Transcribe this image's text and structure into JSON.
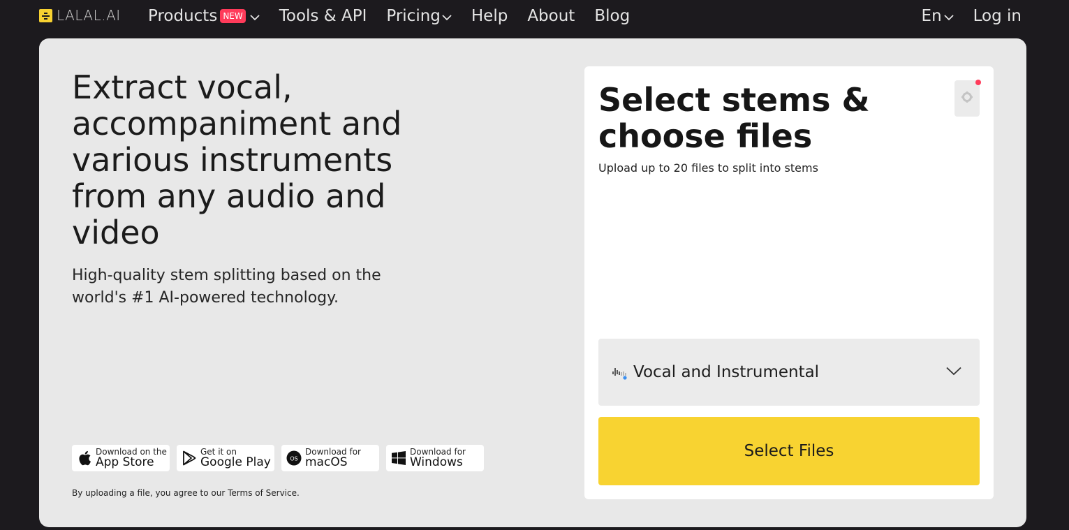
{
  "header": {
    "logo_text": "LALAL.AI",
    "nav": [
      {
        "label": "Products",
        "badge": "NEW",
        "dropdown": true
      },
      {
        "label": "Tools & API"
      },
      {
        "label": "Pricing",
        "dropdown": true
      },
      {
        "label": "Help"
      },
      {
        "label": "About"
      },
      {
        "label": "Blog"
      }
    ],
    "language": "En",
    "login": "Log in"
  },
  "hero": {
    "title": "Extract vocal, accompaniment and various instruments from any audio and video",
    "subtitle": "High-quality stem splitting based on the world's #1 AI-powered technology."
  },
  "stores": [
    {
      "small": "Download on the",
      "big": "App Store",
      "icon": "apple-icon"
    },
    {
      "small": "Get it on",
      "big": "Google Play",
      "icon": "google-play-icon"
    },
    {
      "small": "Download for",
      "big": "macOS",
      "icon": "macos-icon"
    },
    {
      "small": "Download for",
      "big": "Windows",
      "icon": "windows-icon"
    }
  ],
  "tos_text": "By uploading a file, you agree to our Terms of Service.",
  "panel": {
    "title": "Select stems & choose files",
    "subtitle": "Upload up to 20 files to split into stems",
    "stem_option": "Vocal and Instrumental",
    "select_files": "Select Files"
  },
  "colors": {
    "background": "#1c1a1e",
    "card": "#e8e8e8",
    "accent": "#f8d331",
    "badge": "#ff3b5a"
  }
}
